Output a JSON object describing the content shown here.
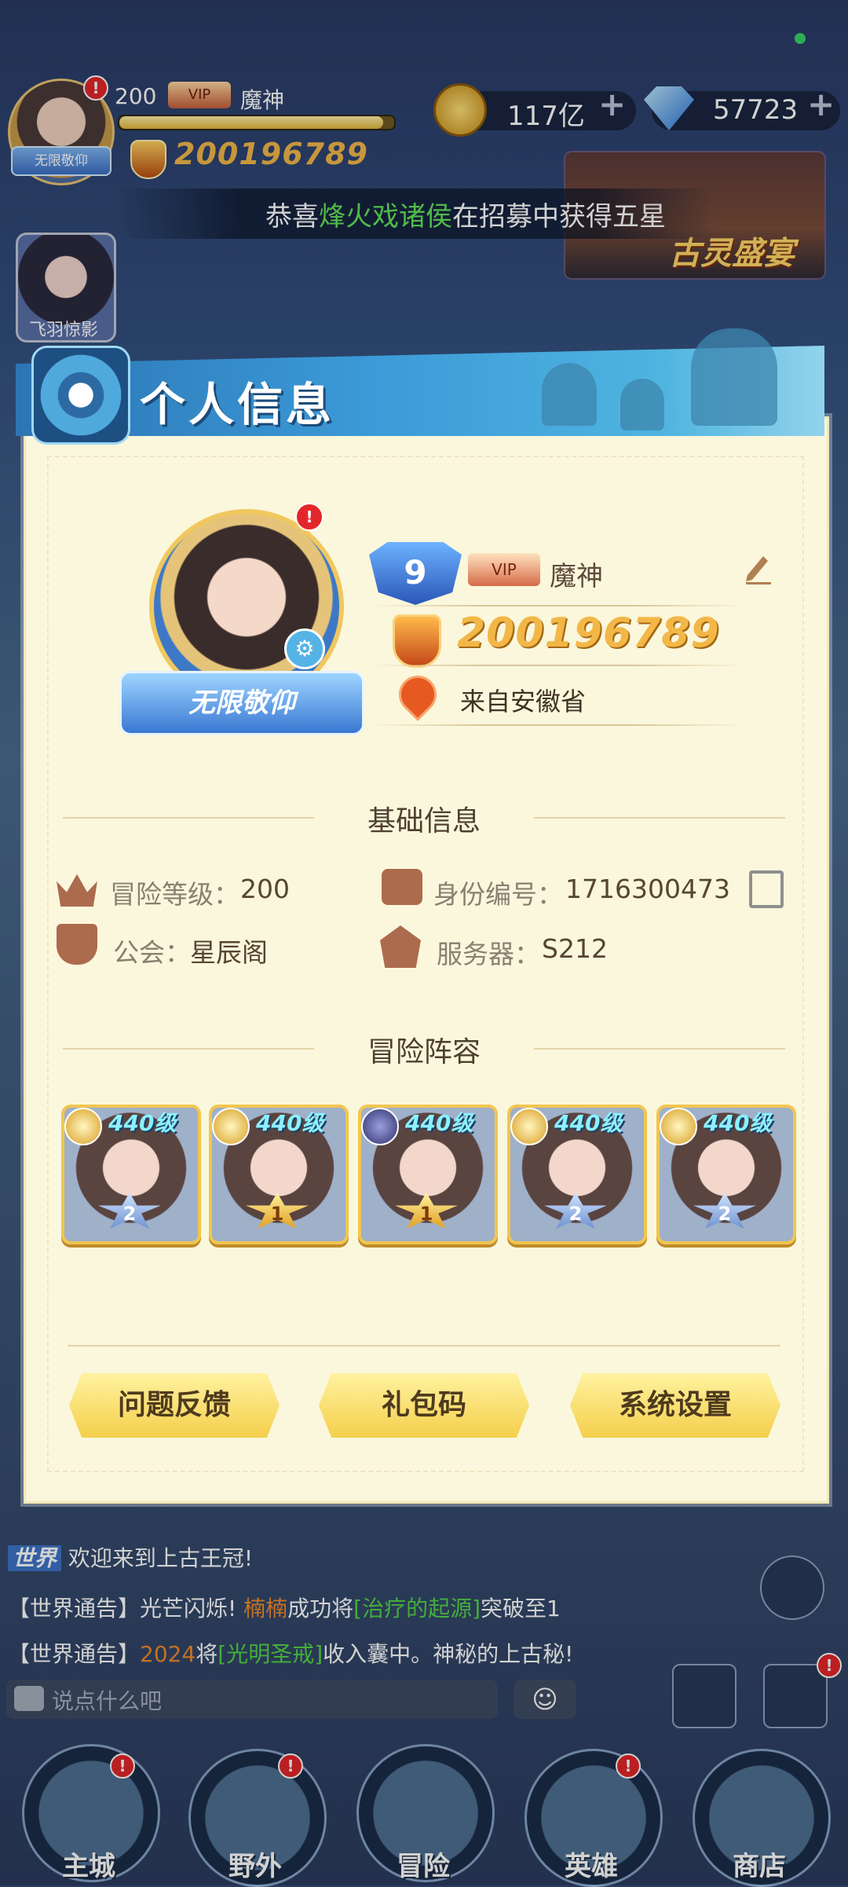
{
  "hud": {
    "level": "200",
    "vip_title": "VIP",
    "player_name": "魔神",
    "exp_fraction": 0.96,
    "power": "200196789",
    "avatar_badge": "无限敬仰",
    "coins": "117亿",
    "gems": "57723",
    "plus": "+",
    "notice_parts": [
      "恭喜",
      "烽火戏诸侯",
      "在招募中获得五星"
    ],
    "event_title": "古灵盛宴",
    "hero_thumb_label": "飞羽惊影"
  },
  "modal": {
    "title": "个人信息",
    "avatar_badge": "无限敬仰",
    "rank_level": "9",
    "vip_title": "VIP",
    "name": "魔神",
    "power": "200196789",
    "location": "来自安徽省",
    "basic_section": "基础信息",
    "adventure_level_label": "冒险等级：",
    "adventure_level": "200",
    "id_label": "身份编号：",
    "id_value": "1716300473",
    "guild_label": "公会：",
    "guild_value": "星辰阁",
    "server_label": "服务器：",
    "server_value": "S212",
    "lineup_section": "冒险阵容",
    "lineup": [
      {
        "level": "440级",
        "stars": "2",
        "element": "light"
      },
      {
        "level": "440级",
        "stars": "1",
        "element": "light"
      },
      {
        "level": "440级",
        "stars": "1",
        "element": "dark"
      },
      {
        "level": "440级",
        "stars": "2",
        "element": "light"
      },
      {
        "level": "440级",
        "stars": "2",
        "element": "light"
      }
    ],
    "buttons": {
      "feedback": "问题反馈",
      "gift_code": "礼包码",
      "settings": "系统设置"
    }
  },
  "chat": {
    "line1_prefix": "世界",
    "line1_text": "欢迎来到上古王冠!",
    "line2": [
      "【世界通告】光芒闪烁! ",
      "楠楠",
      "成功将",
      "[治疗的起源]",
      "突破至1"
    ],
    "line3": [
      "【世界通告】",
      "2024",
      "将",
      "[光明圣戒]",
      "收入囊中。神秘的上古秘!"
    ],
    "input_placeholder": "说点什么吧",
    "emoji": "☺"
  },
  "nav": [
    "主城",
    "野外",
    "冒险",
    "英雄",
    "商店"
  ],
  "badge_mark": "!",
  "colors": {
    "accent_blue": "#3c9bd8",
    "panel": "#fbf7dc",
    "power_gold": "#f3b748",
    "button_yellow": "#f4cf4b"
  }
}
